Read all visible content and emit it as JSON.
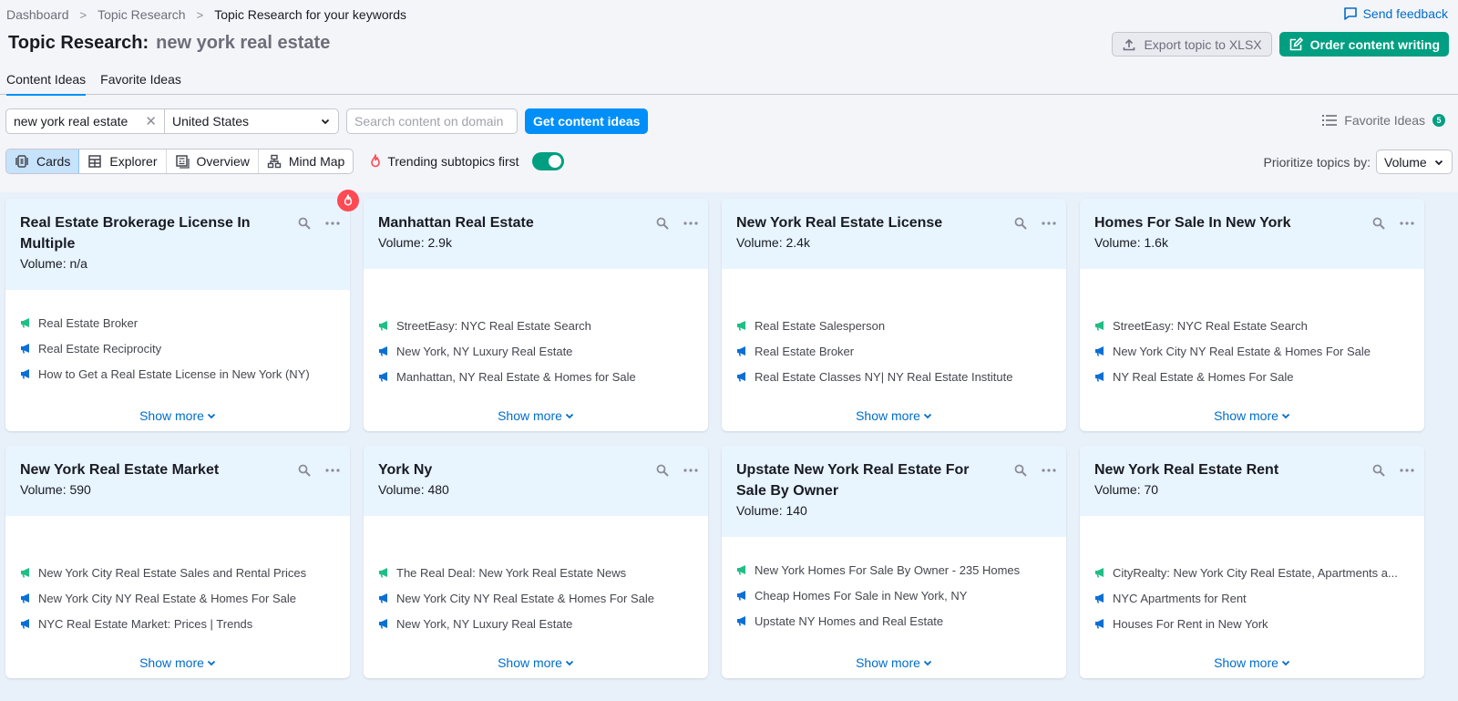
{
  "breadcrumb": [
    "Dashboard",
    "Topic Research",
    "Topic Research for your keywords"
  ],
  "send_feedback": "Send feedback",
  "title": {
    "label": "Topic Research:",
    "keyword": "new york real estate"
  },
  "actions": {
    "export": "Export topic to XLSX",
    "order": "Order content writing"
  },
  "tabs": [
    {
      "label": "Content Ideas",
      "active": true
    },
    {
      "label": "Favorite Ideas",
      "active": false
    }
  ],
  "search": {
    "keyword": "new york real estate",
    "country": "United States",
    "domain_placeholder": "Search content on domain",
    "submit": "Get content ideas"
  },
  "favorite_ideas": {
    "label": "Favorite Ideas",
    "count": "5"
  },
  "views": [
    {
      "label": "Cards",
      "icon": "cards-icon",
      "active": true
    },
    {
      "label": "Explorer",
      "icon": "table-icon",
      "active": false
    },
    {
      "label": "Overview",
      "icon": "overview-icon",
      "active": false
    },
    {
      "label": "Mind Map",
      "icon": "mind-map-icon",
      "active": false
    }
  ],
  "trending": {
    "label": "Trending subtopics first",
    "enabled": true
  },
  "prioritize": {
    "label": "Prioritize topics by:",
    "value": "Volume"
  },
  "colors": {
    "accent": "#008ff8",
    "green": "#009f81",
    "headline_green": "#1fbf84",
    "headline_blue": "#0a6fd6",
    "hot": "#ff4953"
  },
  "show_more": "Show more",
  "cards": [
    {
      "title": "Real Estate Brokerage License In Multiple",
      "volume": "Volume:  n/a",
      "trending": true,
      "headlines": [
        "Real Estate Broker",
        "Real Estate Reciprocity",
        "How to Get a Real Estate License in New York (NY)"
      ]
    },
    {
      "title": "Manhattan Real Estate",
      "volume": "Volume:  2.9k",
      "trending": false,
      "headlines": [
        "StreetEasy: NYC Real Estate Search",
        "New York, NY Luxury Real Estate",
        "Manhattan, NY Real Estate & Homes for Sale"
      ]
    },
    {
      "title": "New York Real Estate License",
      "volume": "Volume:  2.4k",
      "trending": false,
      "headlines": [
        "Real Estate Salesperson",
        "Real Estate Broker",
        "Real Estate Classes NY| NY Real Estate Institute"
      ]
    },
    {
      "title": "Homes For Sale In New York",
      "volume": "Volume:  1.6k",
      "trending": false,
      "headlines": [
        "StreetEasy: NYC Real Estate Search",
        "New York City NY Real Estate & Homes For Sale",
        "NY Real Estate & Homes For Sale"
      ]
    },
    {
      "title": "New York Real Estate Market",
      "volume": "Volume:  590",
      "trending": false,
      "headlines": [
        "New York City Real Estate Sales and Rental Prices",
        "New York City NY Real Estate & Homes For Sale",
        "NYC Real Estate Market: Prices | Trends"
      ]
    },
    {
      "title": "York Ny",
      "volume": "Volume:  480",
      "trending": false,
      "headlines": [
        "The Real Deal: New York Real Estate News",
        "New York City NY Real Estate & Homes For Sale",
        "New York, NY Luxury Real Estate"
      ]
    },
    {
      "title": "Upstate New York Real Estate For Sale By Owner",
      "volume": "Volume:  140",
      "trending": false,
      "headlines": [
        "New York Homes For Sale By Owner - 235 Homes",
        "Cheap Homes For Sale in New York, NY",
        "Upstate NY Homes and Real Estate"
      ]
    },
    {
      "title": "New York Real Estate Rent",
      "volume": "Volume:  70",
      "trending": false,
      "headlines": [
        "CityRealty: New York City Real Estate, Apartments a...",
        "NYC Apartments for Rent",
        "Houses For Rent in New York"
      ]
    }
  ]
}
